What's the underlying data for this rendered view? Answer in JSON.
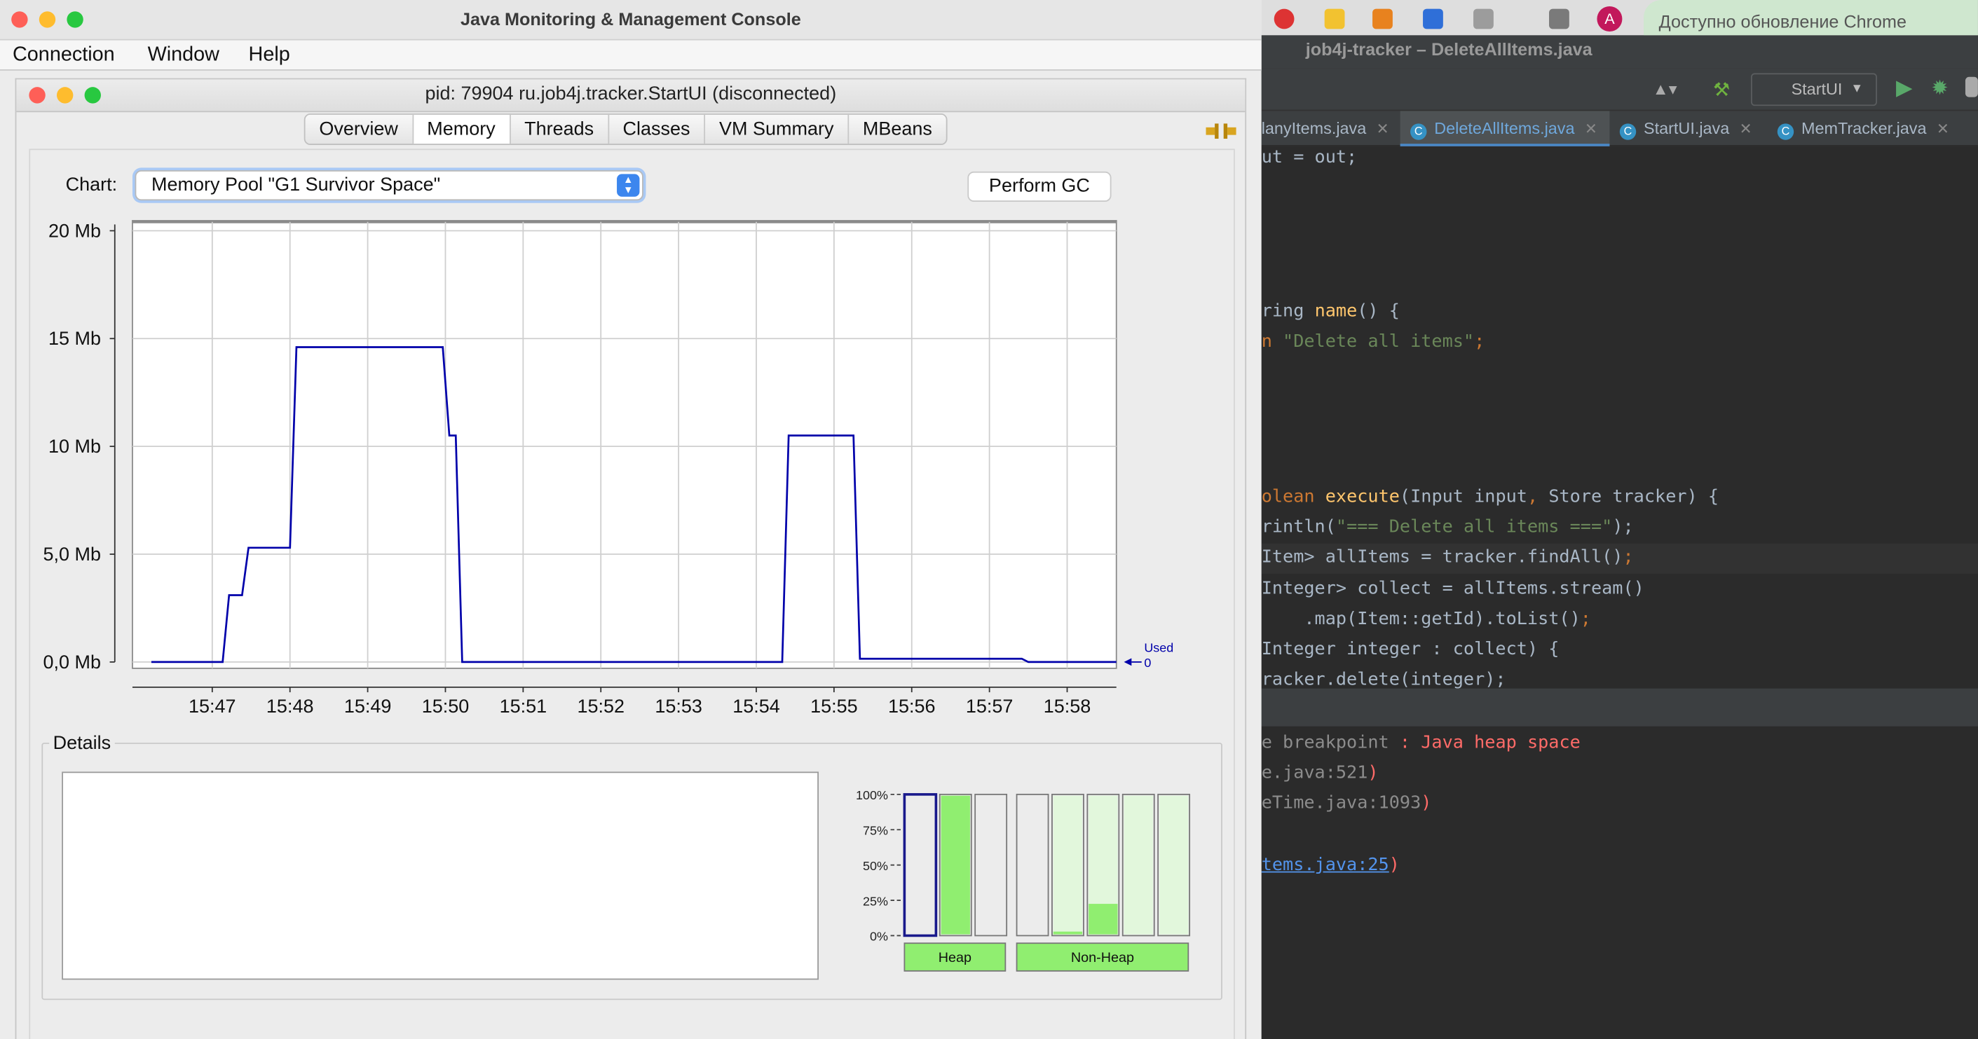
{
  "ide": {
    "window_title": "job4j-tracker – DeleteAllItems.java",
    "chrome_update": "Доступно обновление Chrome",
    "avatar_letter": "A",
    "run_config": "StartUI",
    "tabs": [
      {
        "label": "lanyItems.java",
        "active": false
      },
      {
        "label": "DeleteAllItems.java",
        "active": true
      },
      {
        "label": "StartUI.java",
        "active": false
      },
      {
        "label": "MemTracker.java",
        "active": false
      }
    ],
    "code_lines": [
      {
        "y": 125,
        "parts": [
          [
            "ut = out;",
            "#a9b7c6"
          ]
        ]
      },
      {
        "y": 247,
        "parts": [
          [
            "ring ",
            "#a9b7c6"
          ],
          [
            "name",
            "#ffc66d"
          ],
          [
            "() {",
            "#a9b7c6"
          ]
        ]
      },
      {
        "y": 271,
        "parts": [
          [
            "n ",
            "#cc7832"
          ],
          [
            "\"Delete all items\"",
            "#6a8759"
          ],
          [
            ";",
            "#cc7832"
          ]
        ]
      },
      {
        "y": 394,
        "parts": [
          [
            "olean ",
            "#cc7832"
          ],
          [
            "execute",
            "#ffc66d"
          ],
          [
            "(Input input",
            "#a9b7c6"
          ],
          [
            ", ",
            "#cc7832"
          ],
          [
            "Store tracker) {",
            "#a9b7c6"
          ]
        ]
      },
      {
        "y": 418,
        "parts": [
          [
            "rintln(",
            "#a9b7c6"
          ],
          [
            "\"=== Delete all items ===\"",
            "#6a8759"
          ],
          [
            ");",
            "#a9b7c6"
          ]
        ]
      },
      {
        "y": 442,
        "parts": [
          [
            "Item> allItems = tracker.findAll()",
            "#a9b7c6"
          ],
          [
            ";",
            "#cc7832"
          ]
        ]
      },
      {
        "y": 467,
        "parts": [
          [
            "Integer> collect = allItems.stream()",
            "#a9b7c6"
          ]
        ]
      },
      {
        "y": 491,
        "parts": [
          [
            "    .map(Item::getId).toList()",
            "#a9b7c6"
          ],
          [
            ";",
            "#cc7832"
          ]
        ]
      },
      {
        "y": 515,
        "parts": [
          [
            "Integer integer : collect) {",
            "#a9b7c6"
          ]
        ]
      },
      {
        "y": 539,
        "parts": [
          [
            "racker.delete(integer);",
            "#a9b7c6"
          ]
        ]
      }
    ],
    "console_lines": [
      {
        "y": 589,
        "parts": [
          [
            "e breakpoint",
            "#8c8c8c"
          ],
          [
            " : Java heap space",
            "#ff6b68"
          ]
        ]
      },
      {
        "y": 613,
        "parts": [
          [
            "e.java:521",
            "#8c8c8c"
          ],
          [
            ")",
            "#ff6b68"
          ]
        ]
      },
      {
        "y": 637,
        "parts": [
          [
            "eTime.java:1093",
            "#8c8c8c"
          ],
          [
            ")",
            "#ff6b68"
          ]
        ]
      },
      {
        "y": 686,
        "parts": [
          [
            "tems.java:25",
            "#5394ec"
          ],
          [
            ")",
            "#ff6b68"
          ]
        ]
      }
    ]
  },
  "jconsole": {
    "window_title": "Java Monitoring & Management Console",
    "menu": [
      "Connection",
      "Window",
      "Help"
    ],
    "inner_title": "pid: 79904 ru.job4j.tracker.StartUI (disconnected)",
    "tabs": [
      {
        "label": "Overview",
        "selected": false
      },
      {
        "label": "Memory",
        "selected": true
      },
      {
        "label": "Threads",
        "selected": false
      },
      {
        "label": "Classes",
        "selected": false
      },
      {
        "label": "VM Summary",
        "selected": false
      },
      {
        "label": "MBeans",
        "selected": false
      }
    ],
    "chart_label": "Chart:",
    "chart_select_value": "Memory Pool \"G1 Survivor Space\"",
    "perform_gc_label": "Perform GC",
    "details_label": "Details",
    "bar_axis_labels": [
      "100%",
      "75%",
      "50%",
      "25%",
      "0%"
    ],
    "heap_label": "Heap",
    "nonheap_label": "Non-Heap",
    "heap_bars": [
      {
        "fill": 0.0,
        "selected": true
      },
      {
        "fill": 1.0,
        "selected": false
      },
      {
        "fill": 0.0,
        "selected": false
      }
    ],
    "nonheap_bars": [
      {
        "fill": 0.0,
        "light": 0.0
      },
      {
        "fill": 0.02,
        "light": 1.0
      },
      {
        "fill": 0.22,
        "light": 1.0
      },
      {
        "fill": 0.0,
        "light": 1.0
      },
      {
        "fill": 0.0,
        "light": 1.0
      }
    ],
    "colors": {
      "used_line": "#0000aa",
      "bar_green": "#90ee70",
      "bar_light": "#e2f7dc",
      "bar_selected_border": "#1a1a8c"
    }
  },
  "chart_data": {
    "type": "line",
    "y_tick_labels": [
      "20 Mb",
      "15 Mb",
      "10 Mb",
      "5,0 Mb",
      "0,0 Mb"
    ],
    "y_tick_values": [
      20,
      15,
      10,
      5,
      0
    ],
    "x_tick_labels": [
      "15:47",
      "15:48",
      "15:49",
      "15:50",
      "15:51",
      "15:52",
      "15:53",
      "15:54",
      "15:55",
      "15:56",
      "15:57",
      "15:58"
    ],
    "ylim": [
      0,
      20
    ],
    "xlim": [
      "15:46:13",
      "15:58:38"
    ],
    "grid": true,
    "legend_label": "Used",
    "current_value_label": "0",
    "series": [
      {
        "name": "Used",
        "color": "#0000aa",
        "unit": "Mb",
        "points": [
          [
            "15:46:13",
            0
          ],
          [
            "15:47:08",
            0
          ],
          [
            "15:47:13",
            3.1
          ],
          [
            "15:47:23",
            3.1
          ],
          [
            "15:47:28",
            5.3
          ],
          [
            "15:48:00",
            5.3
          ],
          [
            "15:48:05",
            14.6
          ],
          [
            "15:49:58",
            14.6
          ],
          [
            "15:50:03",
            10.5
          ],
          [
            "15:50:08",
            10.5
          ],
          [
            "15:50:13",
            0
          ],
          [
            "15:54:20",
            0
          ],
          [
            "15:54:25",
            10.5
          ],
          [
            "15:55:15",
            10.5
          ],
          [
            "15:55:20",
            0.15
          ],
          [
            "15:57:25",
            0.15
          ],
          [
            "15:57:30",
            0
          ],
          [
            "15:58:38",
            0
          ]
        ]
      }
    ]
  }
}
